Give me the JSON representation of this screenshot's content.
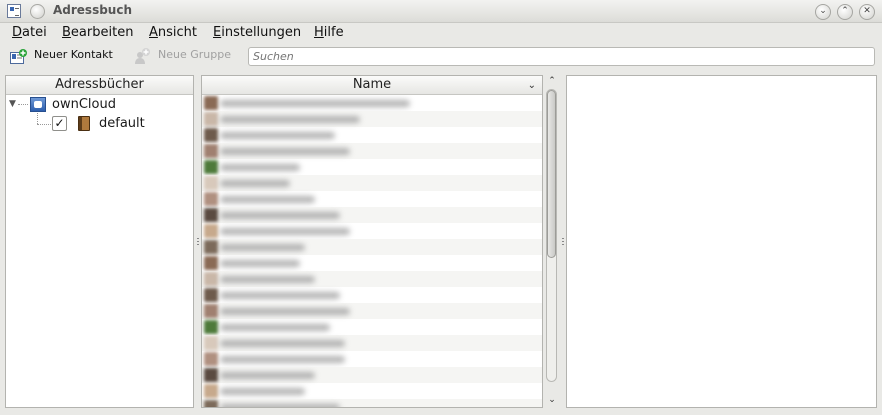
{
  "window": {
    "title": "Adressbuch",
    "buttons": [
      "minimize",
      "maximize",
      "close"
    ]
  },
  "menu": [
    {
      "label": "Datei",
      "accel": "D",
      "rest": "atei"
    },
    {
      "label": "Bearbeiten",
      "accel": "B",
      "rest": "earbeiten"
    },
    {
      "label": "Ansicht",
      "accel": "A",
      "rest": "nsicht"
    },
    {
      "label": "Einstellungen",
      "accel": "E",
      "rest": "instellungen"
    },
    {
      "label": "Hilfe",
      "accel": "H",
      "rest": "ilfe"
    }
  ],
  "toolbar": {
    "new_contact": "Neuer Kontakt",
    "new_group": "Neue Gruppe",
    "search_placeholder": "Suchen"
  },
  "addressbooks": {
    "header": "Adressbücher",
    "root": {
      "label": "ownCloud",
      "icon": "owncloud-icon"
    },
    "child": {
      "label": "default",
      "checked": true,
      "icon": "addressbook-icon"
    }
  },
  "contacts": {
    "header": "Name",
    "row_count": 20
  },
  "colors": {
    "window_bg": "#e9e9e6",
    "panel_bg": "#ffffff",
    "alt_row": "#f5f5f3"
  }
}
